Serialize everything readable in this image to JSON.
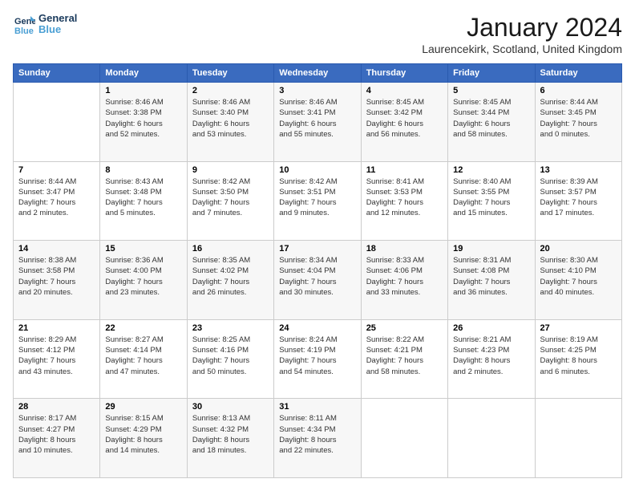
{
  "logo": {
    "line1": "General",
    "line2": "Blue"
  },
  "title": "January 2024",
  "subtitle": "Laurencekirk, Scotland, United Kingdom",
  "columns": [
    "Sunday",
    "Monday",
    "Tuesday",
    "Wednesday",
    "Thursday",
    "Friday",
    "Saturday"
  ],
  "weeks": [
    [
      {
        "num": "",
        "info": ""
      },
      {
        "num": "1",
        "info": "Sunrise: 8:46 AM\nSunset: 3:38 PM\nDaylight: 6 hours\nand 52 minutes."
      },
      {
        "num": "2",
        "info": "Sunrise: 8:46 AM\nSunset: 3:40 PM\nDaylight: 6 hours\nand 53 minutes."
      },
      {
        "num": "3",
        "info": "Sunrise: 8:46 AM\nSunset: 3:41 PM\nDaylight: 6 hours\nand 55 minutes."
      },
      {
        "num": "4",
        "info": "Sunrise: 8:45 AM\nSunset: 3:42 PM\nDaylight: 6 hours\nand 56 minutes."
      },
      {
        "num": "5",
        "info": "Sunrise: 8:45 AM\nSunset: 3:44 PM\nDaylight: 6 hours\nand 58 minutes."
      },
      {
        "num": "6",
        "info": "Sunrise: 8:44 AM\nSunset: 3:45 PM\nDaylight: 7 hours\nand 0 minutes."
      }
    ],
    [
      {
        "num": "7",
        "info": "Sunrise: 8:44 AM\nSunset: 3:47 PM\nDaylight: 7 hours\nand 2 minutes."
      },
      {
        "num": "8",
        "info": "Sunrise: 8:43 AM\nSunset: 3:48 PM\nDaylight: 7 hours\nand 5 minutes."
      },
      {
        "num": "9",
        "info": "Sunrise: 8:42 AM\nSunset: 3:50 PM\nDaylight: 7 hours\nand 7 minutes."
      },
      {
        "num": "10",
        "info": "Sunrise: 8:42 AM\nSunset: 3:51 PM\nDaylight: 7 hours\nand 9 minutes."
      },
      {
        "num": "11",
        "info": "Sunrise: 8:41 AM\nSunset: 3:53 PM\nDaylight: 7 hours\nand 12 minutes."
      },
      {
        "num": "12",
        "info": "Sunrise: 8:40 AM\nSunset: 3:55 PM\nDaylight: 7 hours\nand 15 minutes."
      },
      {
        "num": "13",
        "info": "Sunrise: 8:39 AM\nSunset: 3:57 PM\nDaylight: 7 hours\nand 17 minutes."
      }
    ],
    [
      {
        "num": "14",
        "info": "Sunrise: 8:38 AM\nSunset: 3:58 PM\nDaylight: 7 hours\nand 20 minutes."
      },
      {
        "num": "15",
        "info": "Sunrise: 8:36 AM\nSunset: 4:00 PM\nDaylight: 7 hours\nand 23 minutes."
      },
      {
        "num": "16",
        "info": "Sunrise: 8:35 AM\nSunset: 4:02 PM\nDaylight: 7 hours\nand 26 minutes."
      },
      {
        "num": "17",
        "info": "Sunrise: 8:34 AM\nSunset: 4:04 PM\nDaylight: 7 hours\nand 30 minutes."
      },
      {
        "num": "18",
        "info": "Sunrise: 8:33 AM\nSunset: 4:06 PM\nDaylight: 7 hours\nand 33 minutes."
      },
      {
        "num": "19",
        "info": "Sunrise: 8:31 AM\nSunset: 4:08 PM\nDaylight: 7 hours\nand 36 minutes."
      },
      {
        "num": "20",
        "info": "Sunrise: 8:30 AM\nSunset: 4:10 PM\nDaylight: 7 hours\nand 40 minutes."
      }
    ],
    [
      {
        "num": "21",
        "info": "Sunrise: 8:29 AM\nSunset: 4:12 PM\nDaylight: 7 hours\nand 43 minutes."
      },
      {
        "num": "22",
        "info": "Sunrise: 8:27 AM\nSunset: 4:14 PM\nDaylight: 7 hours\nand 47 minutes."
      },
      {
        "num": "23",
        "info": "Sunrise: 8:25 AM\nSunset: 4:16 PM\nDaylight: 7 hours\nand 50 minutes."
      },
      {
        "num": "24",
        "info": "Sunrise: 8:24 AM\nSunset: 4:19 PM\nDaylight: 7 hours\nand 54 minutes."
      },
      {
        "num": "25",
        "info": "Sunrise: 8:22 AM\nSunset: 4:21 PM\nDaylight: 7 hours\nand 58 minutes."
      },
      {
        "num": "26",
        "info": "Sunrise: 8:21 AM\nSunset: 4:23 PM\nDaylight: 8 hours\nand 2 minutes."
      },
      {
        "num": "27",
        "info": "Sunrise: 8:19 AM\nSunset: 4:25 PM\nDaylight: 8 hours\nand 6 minutes."
      }
    ],
    [
      {
        "num": "28",
        "info": "Sunrise: 8:17 AM\nSunset: 4:27 PM\nDaylight: 8 hours\nand 10 minutes."
      },
      {
        "num": "29",
        "info": "Sunrise: 8:15 AM\nSunset: 4:29 PM\nDaylight: 8 hours\nand 14 minutes."
      },
      {
        "num": "30",
        "info": "Sunrise: 8:13 AM\nSunset: 4:32 PM\nDaylight: 8 hours\nand 18 minutes."
      },
      {
        "num": "31",
        "info": "Sunrise: 8:11 AM\nSunset: 4:34 PM\nDaylight: 8 hours\nand 22 minutes."
      },
      {
        "num": "",
        "info": ""
      },
      {
        "num": "",
        "info": ""
      },
      {
        "num": "",
        "info": ""
      }
    ]
  ]
}
